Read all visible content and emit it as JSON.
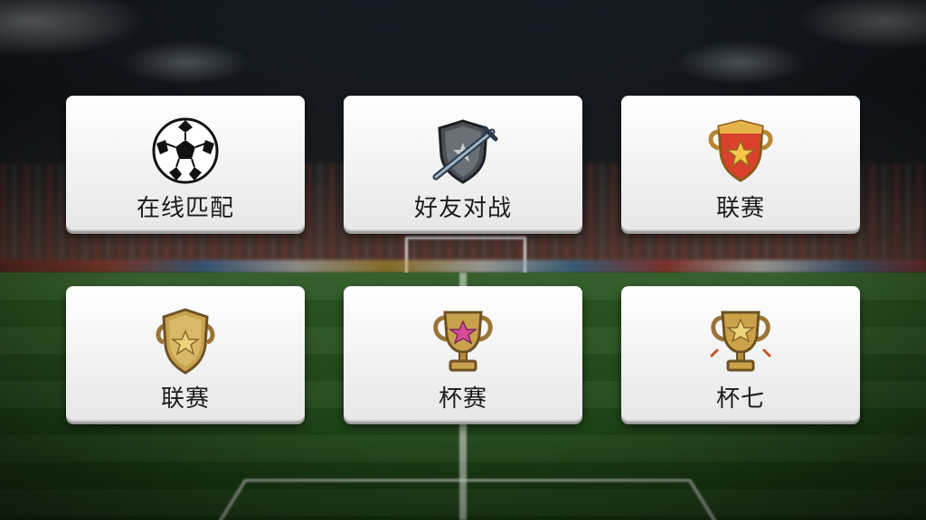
{
  "menu": {
    "items": [
      {
        "label": "在线匹配",
        "icon": "soccer-ball-icon"
      },
      {
        "label": "好友对战",
        "icon": "shield-sword-icon"
      },
      {
        "label": "联赛",
        "icon": "red-shield-star-icon"
      },
      {
        "label": "联赛",
        "icon": "gold-shield-star-icon"
      },
      {
        "label": "杯赛",
        "icon": "trophy-pink-star-icon"
      },
      {
        "label": "杯七",
        "icon": "trophy-gold-star-icon"
      }
    ]
  },
  "colors": {
    "card_bg": "#f4f4f4",
    "label_text": "#1b1b1b",
    "gold": "#c9a24e",
    "red_shield": "#d9412c"
  }
}
